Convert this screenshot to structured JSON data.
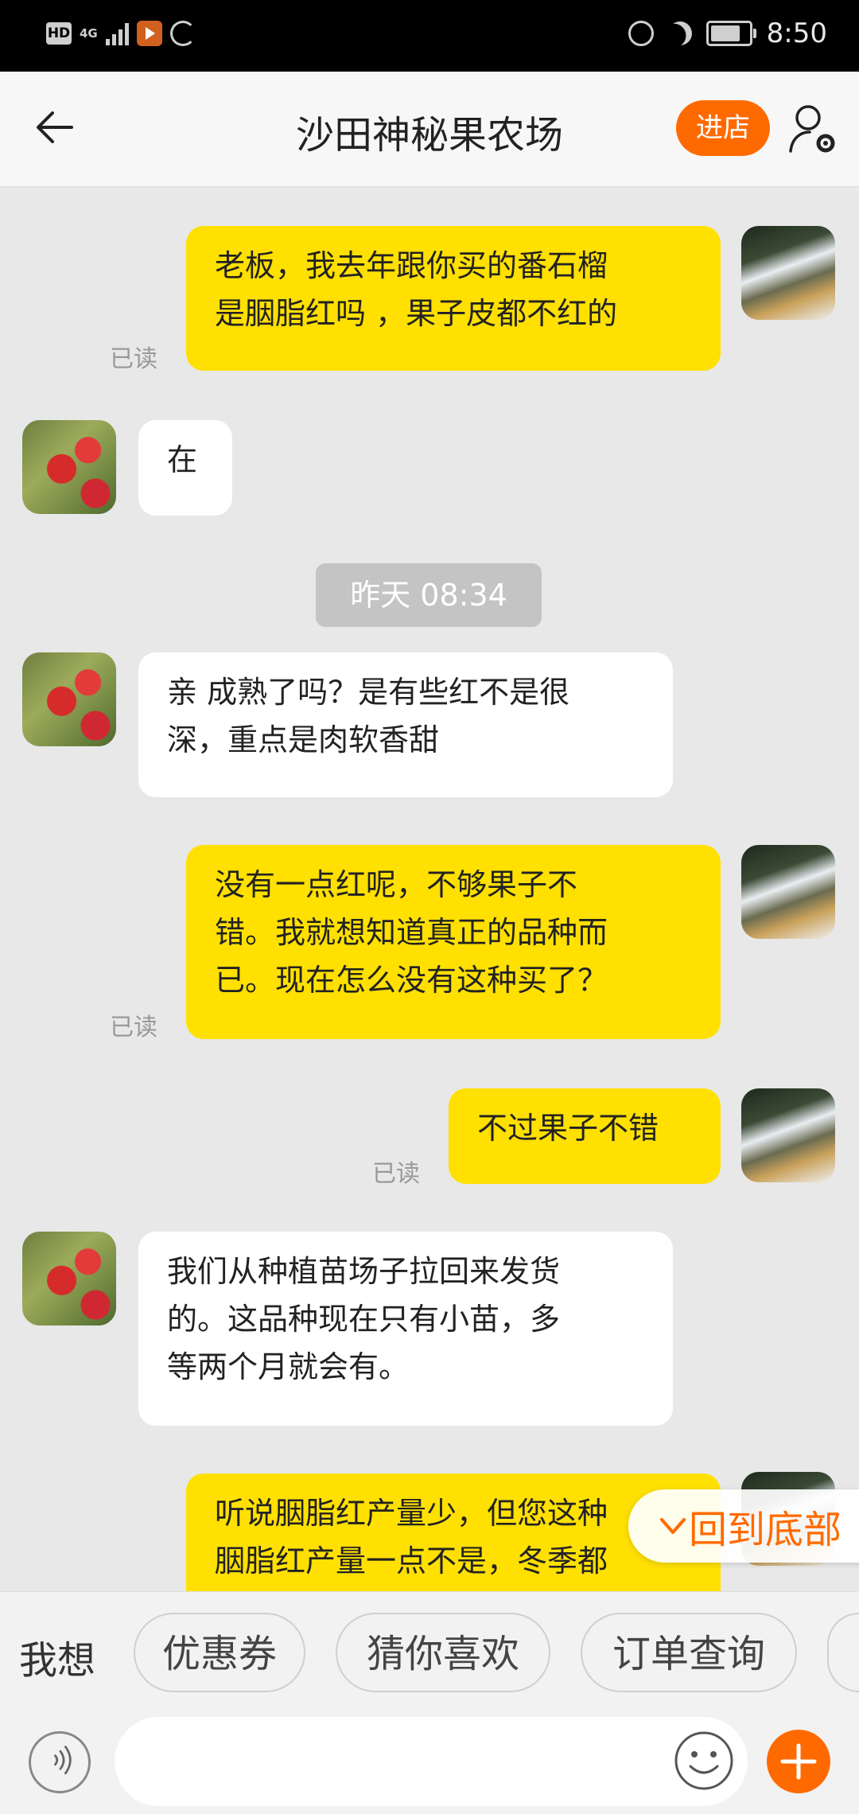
{
  "status_bar": {
    "hd": "HD",
    "network": "4G",
    "time": "8:50",
    "icons": [
      "hd-icon",
      "signal-icon",
      "video-app-icon",
      "sync-icon",
      "alarm-icon",
      "moon-icon",
      "battery-icon"
    ]
  },
  "header": {
    "title": "沙田神秘果农场",
    "shop_button": "进店",
    "icons": [
      "back-arrow-icon",
      "user-settings-icon"
    ]
  },
  "messages": [
    {
      "side": "mine",
      "text": "老板，我去年跟你买的番石榴\n是胭脂红吗 ，果子皮都不红的",
      "read": "已读"
    },
    {
      "side": "theirs",
      "text": "在"
    },
    {
      "side": "timestamp",
      "text": "昨天 08:34"
    },
    {
      "side": "theirs",
      "text": "亲 成熟了吗？是有些红不是很\n深，重点是肉软香甜"
    },
    {
      "side": "mine",
      "text": "没有一点红呢，不够果子不\n错。我就想知道真正的品种而\n已。现在怎么没有这种买了？",
      "read": "已读"
    },
    {
      "side": "mine",
      "text": "不过果子不错",
      "read": "已读"
    },
    {
      "side": "theirs",
      "text": "我们从种植苗场子拉回来发货\n的。这品种现在只有小苗，多\n等两个月就会有。"
    },
    {
      "side": "mine",
      "text": "听说胭脂红产量少，但您这种\n胭脂红产量一点不是，冬季都"
    }
  ],
  "scroll_to_bottom": "回到底部",
  "quick_bar": {
    "label": "我想",
    "chips": [
      "优惠券",
      "猜你喜欢",
      "订单查询",
      ""
    ]
  },
  "input_bar": {
    "placeholder": "",
    "icons": [
      "voice-icon",
      "emoji-icon",
      "plus-icon"
    ]
  },
  "colors": {
    "accent": "#ff6a00",
    "my_bubble": "#ffe000",
    "their_bubble": "#ffffff",
    "background": "#e8e8e8"
  }
}
